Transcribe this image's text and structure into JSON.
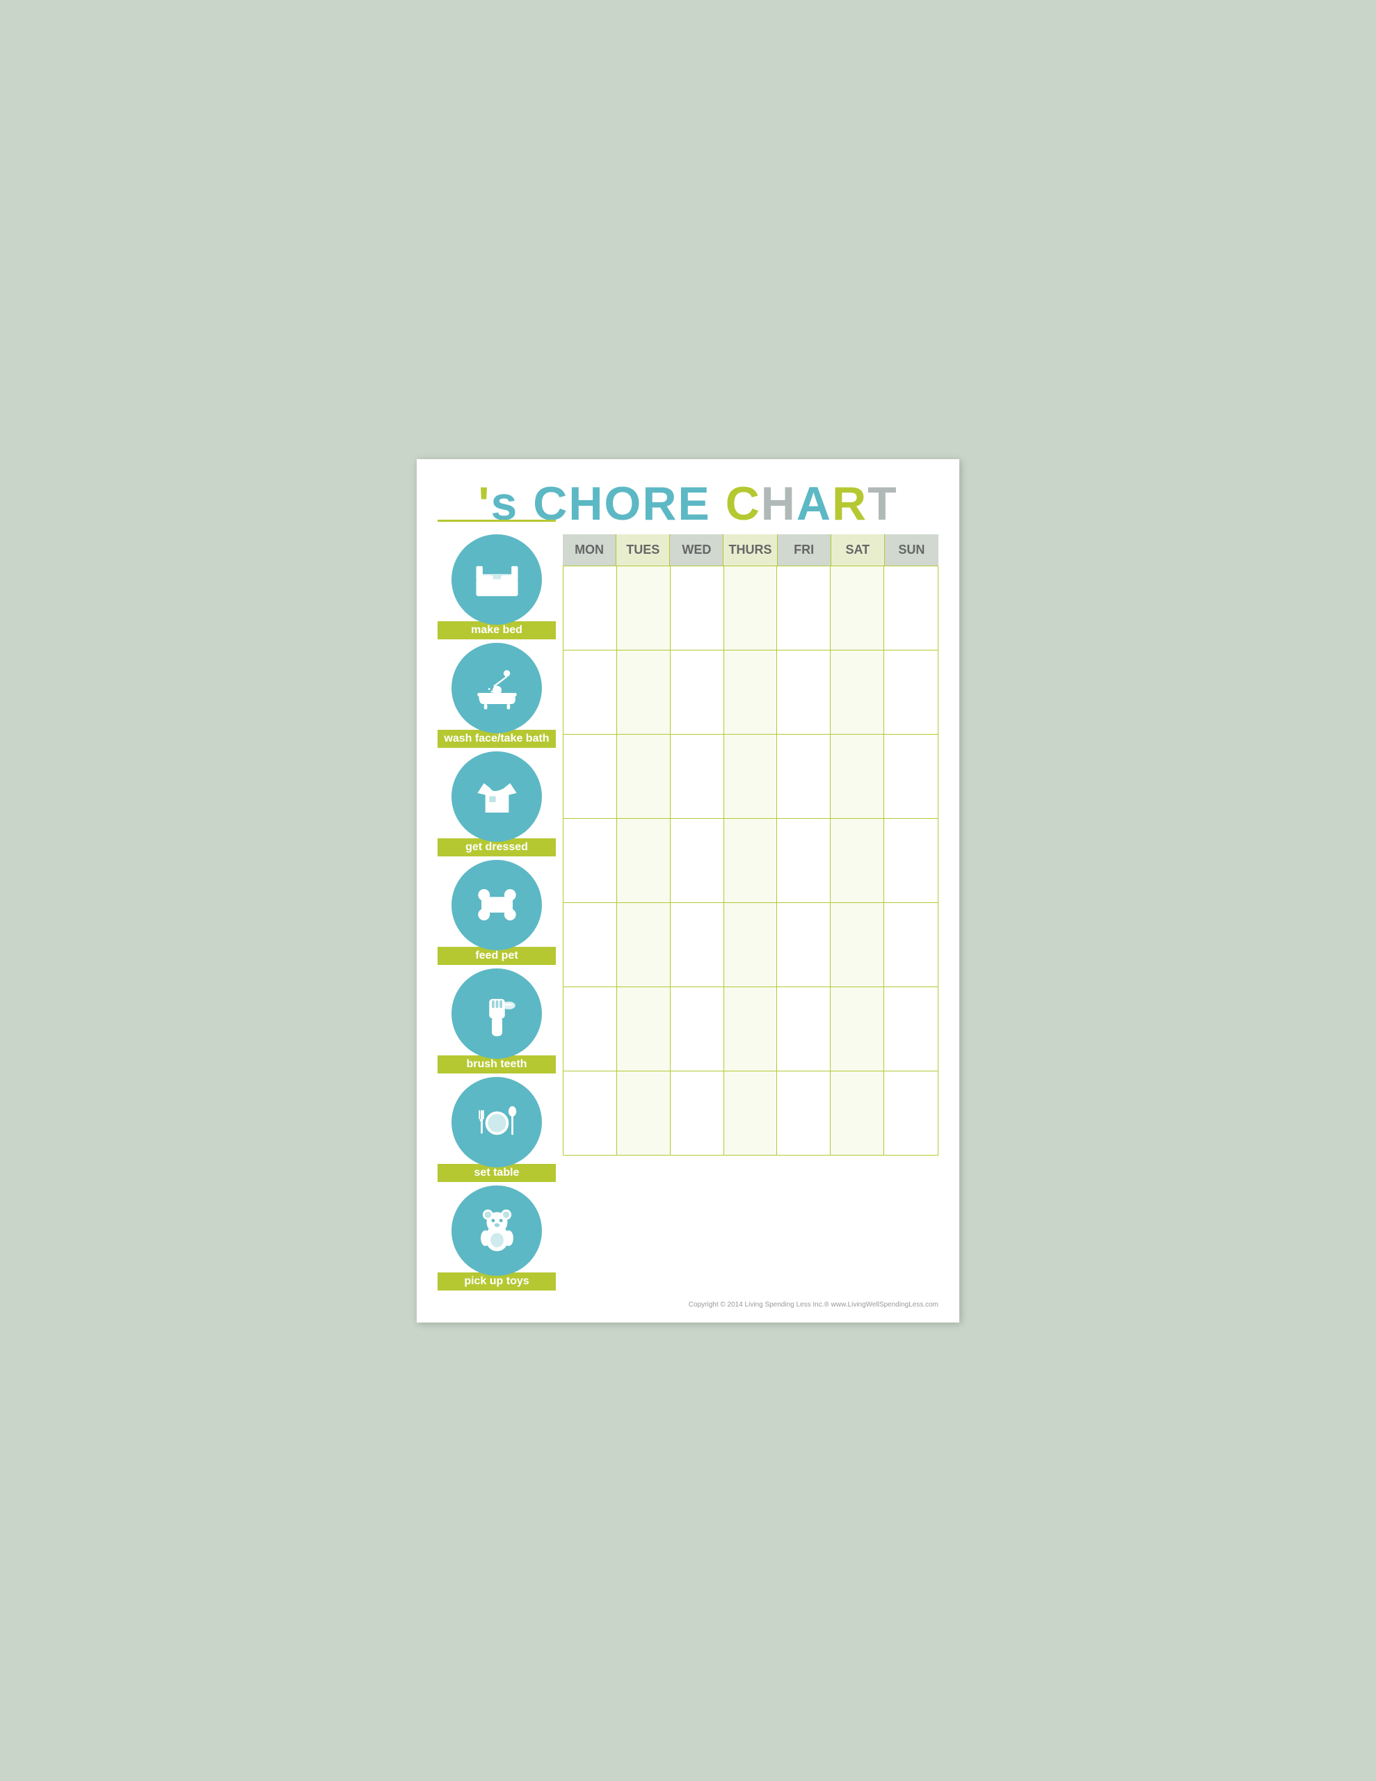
{
  "header": {
    "apostrophe": "'s",
    "chore": "CHORE",
    "chart": "CHART",
    "title_full": "'s CHORE CHART"
  },
  "days": [
    {
      "label": "MON",
      "alt": false
    },
    {
      "label": "TUES",
      "alt": true
    },
    {
      "label": "WED",
      "alt": false
    },
    {
      "label": "THURS",
      "alt": true
    },
    {
      "label": "FRI",
      "alt": false
    },
    {
      "label": "SAT",
      "alt": true
    },
    {
      "label": "SUN",
      "alt": false
    }
  ],
  "chores": [
    {
      "label": "make bed",
      "icon": "bed"
    },
    {
      "label": "wash face/take bath",
      "icon": "bath"
    },
    {
      "label": "get dressed",
      "icon": "shirt"
    },
    {
      "label": "feed pet",
      "icon": "bone"
    },
    {
      "label": "brush teeth",
      "icon": "toothbrush"
    },
    {
      "label": "set table",
      "icon": "table"
    },
    {
      "label": "pick up toys",
      "icon": "toy"
    }
  ],
  "footer": {
    "copyright": "Copyright © 2014 Living Spending Less Inc.®   www.LivingWellSpendingLess.com"
  }
}
